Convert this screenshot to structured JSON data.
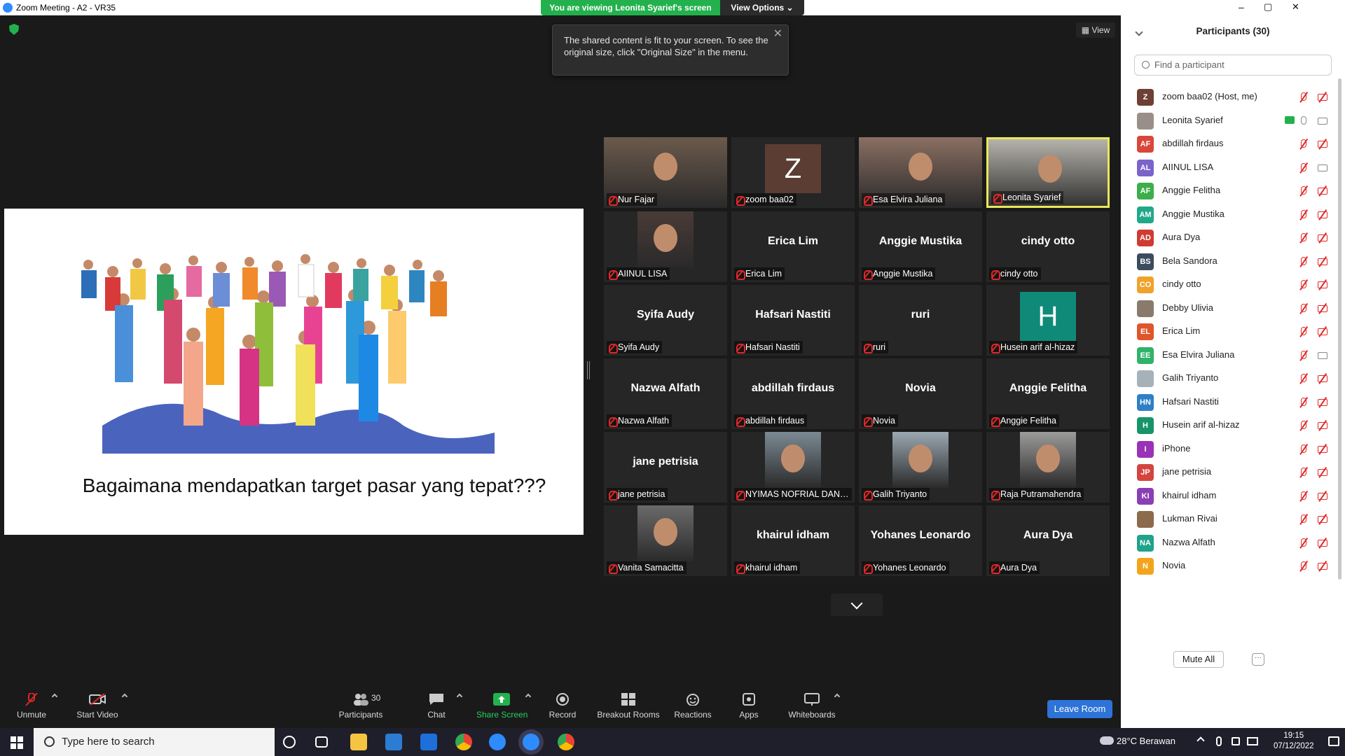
{
  "window": {
    "title": "Zoom Meeting - A2 - VR35",
    "controls": [
      "–",
      "▢",
      "✕"
    ]
  },
  "banner": {
    "viewing_text": "You are viewing Leonita Syarief's screen",
    "view_options": "View Options ⌄"
  },
  "top_right_view": "▦ View",
  "tooltip": {
    "text": "The shared content is fit to your screen. To see the original size, click \"Original Size\" in the menu."
  },
  "slide": {
    "caption": "Bagaimana mendapatkan target pasar yang tepat???"
  },
  "gallery": [
    {
      "name": "Nur Fajar",
      "type": "photo",
      "color": "#6b5a4c"
    },
    {
      "name": "zoom baa02",
      "type": "initial",
      "initial": "Z",
      "color": "#5b3d33"
    },
    {
      "name": "Esa Elvira Juliana",
      "type": "photo",
      "color": "#8a6f62"
    },
    {
      "name": "Leonita Syarief",
      "type": "photo",
      "color": "#b5b3ab",
      "active": true
    },
    {
      "name": "AIINUL LISA",
      "type": "photo",
      "color": "#4a3b37"
    },
    {
      "name": "Erica Lim",
      "type": "text"
    },
    {
      "name": "Anggie Mustika",
      "type": "text"
    },
    {
      "name": "cindy otto",
      "type": "text"
    },
    {
      "name": "Syifa Audy",
      "type": "text"
    },
    {
      "name": "Hafsari Nastiti",
      "type": "text"
    },
    {
      "name": "ruri",
      "type": "text"
    },
    {
      "name": "Husein arif al-hizaz",
      "type": "initial",
      "initial": "H",
      "color": "#0f8a78"
    },
    {
      "name": "Nazwa Alfath",
      "type": "text"
    },
    {
      "name": "abdillah firdaus",
      "type": "text"
    },
    {
      "name": "Novia",
      "type": "text"
    },
    {
      "name": "Anggie Felitha",
      "type": "text"
    },
    {
      "name": "jane petrisia",
      "type": "text"
    },
    {
      "name": "NYIMAS NOFRIAL DANI...",
      "type": "photo",
      "color": "#7c8a94"
    },
    {
      "name": "Galih Triyanto",
      "type": "photo",
      "color": "#9aa8b1"
    },
    {
      "name": "Raja Putramahendra",
      "type": "photo",
      "color": "#9b9c9a"
    },
    {
      "name": "Vanita Samacitta",
      "type": "photo",
      "color": "#6a6a6a"
    },
    {
      "name": "khairul idham",
      "type": "text"
    },
    {
      "name": "Yohanes Leonardo",
      "type": "text"
    },
    {
      "name": "Aura Dya",
      "type": "text"
    }
  ],
  "toolbar": {
    "unmute": "Unmute",
    "start_video": "Start Video",
    "participants": "Participants",
    "participants_count": "30",
    "chat": "Chat",
    "share_screen": "Share Screen",
    "record": "Record",
    "breakout_rooms": "Breakout Rooms",
    "reactions": "Reactions",
    "apps": "Apps",
    "whiteboards": "Whiteboards",
    "leave_room": "Leave Room"
  },
  "participants_panel": {
    "title": "Participants (30)",
    "search_placeholder": "Find a participant",
    "mute_all": "Mute All",
    "more": "···",
    "list": [
      {
        "name": "zoom baa02 (Host, me)",
        "initials": "Z",
        "color": "#6e3f35",
        "mic": "muted",
        "cam": "off"
      },
      {
        "name": "Leonita Syarief",
        "initials": "",
        "color": "#9a8f88",
        "mic": "on",
        "cam": "on",
        "sharing": true
      },
      {
        "name": "abdillah firdaus",
        "initials": "AF",
        "color": "#d9473a",
        "mic": "muted",
        "cam": "off"
      },
      {
        "name": "AIINUL LISA",
        "initials": "AL",
        "color": "#7a64c9",
        "mic": "muted",
        "cam": "on"
      },
      {
        "name": "Anggie Felitha",
        "initials": "AF",
        "color": "#3cae4a",
        "mic": "muted",
        "cam": "off"
      },
      {
        "name": "Anggie Mustika",
        "initials": "AM",
        "color": "#21a88a",
        "mic": "muted",
        "cam": "off"
      },
      {
        "name": "Aura Dya",
        "initials": "AD",
        "color": "#cf3b33",
        "mic": "muted",
        "cam": "off"
      },
      {
        "name": "Bela Sandora",
        "initials": "BS",
        "color": "#3c4c5e",
        "mic": "muted",
        "cam": "off"
      },
      {
        "name": "cindy otto",
        "initials": "CO",
        "color": "#f0a22a",
        "mic": "muted",
        "cam": "off"
      },
      {
        "name": "Debby Ulivia",
        "initials": "",
        "color": "#8a7a6c",
        "mic": "muted",
        "cam": "off"
      },
      {
        "name": "Erica Lim",
        "initials": "EL",
        "color": "#e0552a",
        "mic": "muted",
        "cam": "off"
      },
      {
        "name": "Esa Elvira Juliana",
        "initials": "EE",
        "color": "#2fb36a",
        "mic": "muted",
        "cam": "on"
      },
      {
        "name": "Galih Triyanto",
        "initials": "",
        "color": "#a6b2b8",
        "mic": "muted",
        "cam": "off"
      },
      {
        "name": "Hafsari Nastiti",
        "initials": "HN",
        "color": "#2e7fc6",
        "mic": "muted",
        "cam": "off"
      },
      {
        "name": "Husein arif al-hizaz",
        "initials": "H",
        "color": "#17946a",
        "mic": "muted",
        "cam": "off"
      },
      {
        "name": "iPhone",
        "initials": "I",
        "color": "#9a32b8",
        "mic": "muted",
        "cam": "off"
      },
      {
        "name": "jane petrisia",
        "initials": "JP",
        "color": "#d4453f",
        "mic": "muted",
        "cam": "off"
      },
      {
        "name": "khairul idham",
        "initials": "KI",
        "color": "#8a3fb5",
        "mic": "muted",
        "cam": "off"
      },
      {
        "name": "Lukman Rivai",
        "initials": "",
        "color": "#8c6a4c",
        "mic": "muted",
        "cam": "off"
      },
      {
        "name": "Nazwa Alfath",
        "initials": "NA",
        "color": "#1fa38a",
        "mic": "muted",
        "cam": "off"
      },
      {
        "name": "Novia",
        "initials": "N",
        "color": "#f2a51c",
        "mic": "muted",
        "cam": "off"
      }
    ]
  },
  "taskbar": {
    "search_placeholder": "Type here to search",
    "weather": "28°C  Berawan",
    "time": "19:15",
    "date": "07/12/2022"
  }
}
